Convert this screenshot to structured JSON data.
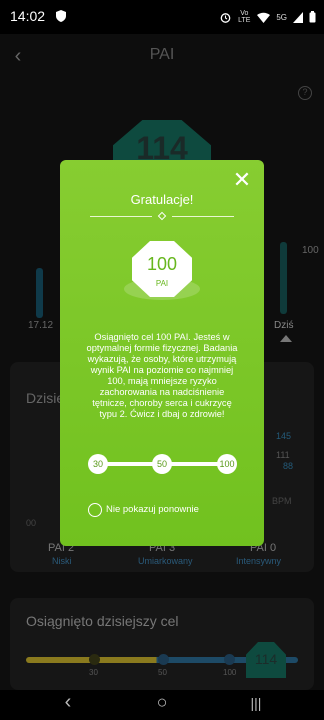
{
  "status": {
    "time": "14:02",
    "volte": "Vo LTE",
    "network": "5G"
  },
  "app": {
    "title": "PAI",
    "back_glyph": "‹"
  },
  "background": {
    "hex_value": "114",
    "date_label": "17.12",
    "max_label": "100",
    "today_label": "Dziś",
    "card_title": "Dzisie",
    "hr_values": [
      "145",
      "111",
      "88"
    ],
    "bpm_label": "BPM",
    "time_label": "00",
    "pai_levels": [
      {
        "value": "PAI 2",
        "label": "Niski"
      },
      {
        "value": "PAI 3",
        "label": "Umiarkowany"
      },
      {
        "value": "PAI 0",
        "label": "Intensywny"
      }
    ],
    "goal_title": "Osiągnięto dzisiejszy cel",
    "goal_marks": [
      "30",
      "50",
      "100"
    ],
    "goal_value": "114"
  },
  "modal": {
    "title": "Gratulacje!",
    "badge_value": "100",
    "badge_unit": "PAI",
    "message": "Osiągnięto cel 100 PAI. Jesteś w optymalnej formie fizycznej. Badania wykazują, że osoby, które utrzymują wynik PAI na poziomie co najmniej 100, mają mniejsze ryzyko zachorowania na nadciśnienie tętnicze, choroby serca i cukrzycę typu 2. Ćwicz i dbaj o zdrowie!",
    "slider_marks": [
      "30",
      "50",
      "100"
    ],
    "checkbox_label": "Nie pokazuj ponownie",
    "close_glyph": "✕"
  },
  "navbar": {
    "back": "‹",
    "home": "○",
    "recents": "|||"
  },
  "colors": {
    "modal_green": "#7ac72a",
    "accent_teal": "#0e4a3f"
  }
}
